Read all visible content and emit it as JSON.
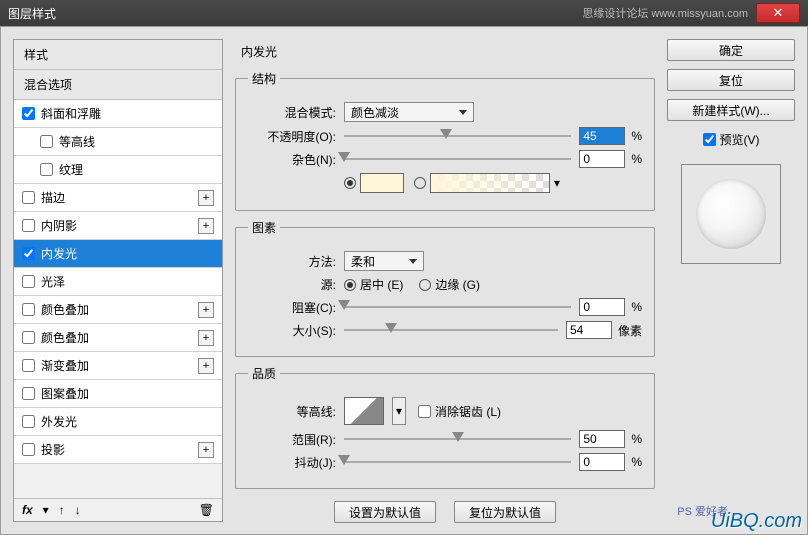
{
  "title_bar": {
    "title": "图层样式",
    "right_text": "思缘设计论坛  www.missyuan.com"
  },
  "left": {
    "styles_label": "样式",
    "blend_label": "混合选项",
    "items": [
      {
        "label": "斜面和浮雕",
        "checked": true,
        "plus": false,
        "indent": 0
      },
      {
        "label": "等高线",
        "checked": false,
        "plus": false,
        "indent": 1
      },
      {
        "label": "纹理",
        "checked": false,
        "plus": false,
        "indent": 1
      },
      {
        "label": "描边",
        "checked": false,
        "plus": true,
        "indent": 0
      },
      {
        "label": "内阴影",
        "checked": false,
        "plus": true,
        "indent": 0
      },
      {
        "label": "内发光",
        "checked": true,
        "plus": false,
        "indent": 0,
        "selected": true
      },
      {
        "label": "光泽",
        "checked": false,
        "plus": false,
        "indent": 0
      },
      {
        "label": "颜色叠加",
        "checked": false,
        "plus": true,
        "indent": 0
      },
      {
        "label": "颜色叠加",
        "checked": false,
        "plus": true,
        "indent": 0
      },
      {
        "label": "渐变叠加",
        "checked": false,
        "plus": true,
        "indent": 0
      },
      {
        "label": "图案叠加",
        "checked": false,
        "plus": false,
        "indent": 0
      },
      {
        "label": "外发光",
        "checked": false,
        "plus": false,
        "indent": 0
      },
      {
        "label": "投影",
        "checked": false,
        "plus": true,
        "indent": 0
      }
    ],
    "fx": "fx"
  },
  "mid": {
    "title": "内发光",
    "g1": {
      "legend": "结构",
      "blend_mode_label": "混合模式:",
      "blend_mode": "颜色减淡",
      "opacity_label": "不透明度(O):",
      "opacity": "45",
      "pct": "%",
      "noise_label": "杂色(N):",
      "noise": "0"
    },
    "g2": {
      "legend": "图素",
      "method_label": "方法:",
      "method": "柔和",
      "source_label": "源:",
      "center": "居中 (E)",
      "edge": "边缘 (G)",
      "choke_label": "阻塞(C):",
      "choke": "0",
      "size_label": "大小(S):",
      "size": "54",
      "px": "像素"
    },
    "g3": {
      "legend": "品质",
      "contour_label": "等高线:",
      "aa_label": "消除锯齿 (L)",
      "range_label": "范围(R):",
      "range": "50",
      "jitter_label": "抖动(J):",
      "jitter": "0"
    },
    "btns": {
      "default": "设置为默认值",
      "reset": "复位为默认值"
    }
  },
  "right": {
    "ok": "确定",
    "cancel": "复位",
    "new": "新建样式(W)...",
    "preview": "预览(V)"
  },
  "wm": {
    "a": "PS 爱好者",
    "b": "UiBQ.com"
  }
}
